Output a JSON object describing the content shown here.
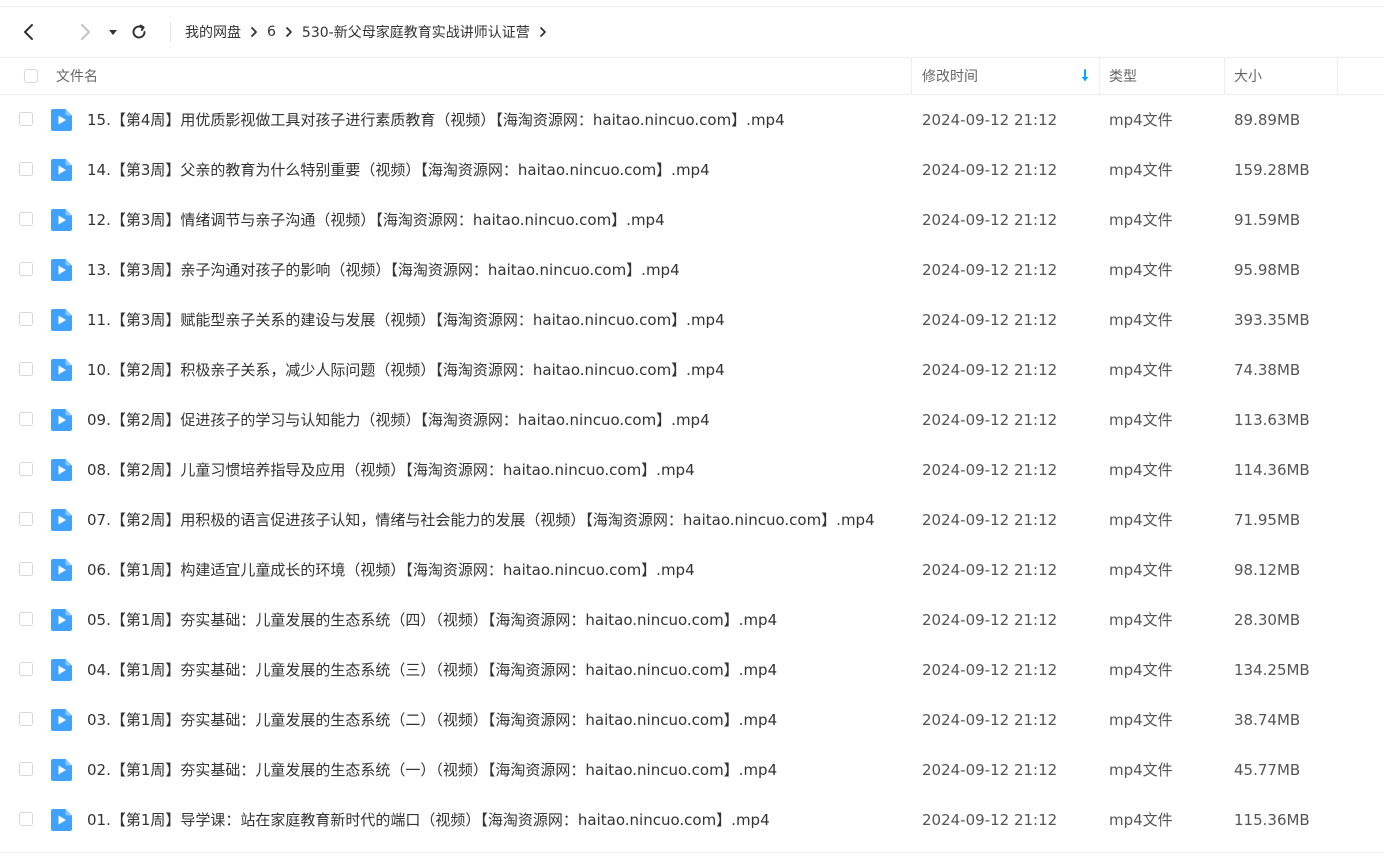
{
  "nav": {
    "back_icon": "chevron-left-icon",
    "forward_icon": "chevron-right-icon",
    "history_icon": "caret-down-icon",
    "refresh_icon": "refresh-icon"
  },
  "breadcrumb": [
    "我的网盘",
    "6",
    "530-新父母家庭教育实战讲师认证营"
  ],
  "columns": {
    "name": "文件名",
    "modified": "修改时间",
    "type": "类型",
    "size": "大小",
    "sort_icon": "arrow-down-icon",
    "accent_color": "#06a7ff"
  },
  "files": [
    {
      "name": "15.【第4周】用优质影视做工具对孩子进行素质教育（视频）【海淘资源网：haitao.nincuo.com】.mp4",
      "modified": "2024-09-12 21:12",
      "type": "mp4文件",
      "size": "89.89MB"
    },
    {
      "name": "14.【第3周】父亲的教育为什么特别重要（视频）【海淘资源网：haitao.nincuo.com】.mp4",
      "modified": "2024-09-12 21:12",
      "type": "mp4文件",
      "size": "159.28MB"
    },
    {
      "name": "12.【第3周】情绪调节与亲子沟通（视频）【海淘资源网：haitao.nincuo.com】.mp4",
      "modified": "2024-09-12 21:12",
      "type": "mp4文件",
      "size": "91.59MB"
    },
    {
      "name": "13.【第3周】亲子沟通对孩子的影响（视频）【海淘资源网：haitao.nincuo.com】.mp4",
      "modified": "2024-09-12 21:12",
      "type": "mp4文件",
      "size": "95.98MB"
    },
    {
      "name": "11.【第3周】赋能型亲子关系的建设与发展（视频）【海淘资源网：haitao.nincuo.com】.mp4",
      "modified": "2024-09-12 21:12",
      "type": "mp4文件",
      "size": "393.35MB"
    },
    {
      "name": "10.【第2周】积极亲子关系，减少人际问题（视频）【海淘资源网：haitao.nincuo.com】.mp4",
      "modified": "2024-09-12 21:12",
      "type": "mp4文件",
      "size": "74.38MB"
    },
    {
      "name": "09.【第2周】促进孩子的学习与认知能力（视频）【海淘资源网：haitao.nincuo.com】.mp4",
      "modified": "2024-09-12 21:12",
      "type": "mp4文件",
      "size": "113.63MB"
    },
    {
      "name": "08.【第2周】儿童习惯培养指导及应用（视频）【海淘资源网：haitao.nincuo.com】.mp4",
      "modified": "2024-09-12 21:12",
      "type": "mp4文件",
      "size": "114.36MB"
    },
    {
      "name": "07.【第2周】用积极的语言促进孩子认知，情绪与社会能力的发展（视频）【海淘资源网：haitao.nincuo.com】.mp4",
      "modified": "2024-09-12 21:12",
      "type": "mp4文件",
      "size": "71.95MB"
    },
    {
      "name": "06.【第1周】构建适宜儿童成长的环境（视频）【海淘资源网：haitao.nincuo.com】.mp4",
      "modified": "2024-09-12 21:12",
      "type": "mp4文件",
      "size": "98.12MB"
    },
    {
      "name": "05.【第1周】夯实基础：儿童发展的生态系统（四）（视频）【海淘资源网：haitao.nincuo.com】.mp4",
      "modified": "2024-09-12 21:12",
      "type": "mp4文件",
      "size": "28.30MB"
    },
    {
      "name": "04.【第1周】夯实基础：儿童发展的生态系统（三）（视频）【海淘资源网：haitao.nincuo.com】.mp4",
      "modified": "2024-09-12 21:12",
      "type": "mp4文件",
      "size": "134.25MB"
    },
    {
      "name": "03.【第1周】夯实基础：儿童发展的生态系统（二）（视频）【海淘资源网：haitao.nincuo.com】.mp4",
      "modified": "2024-09-12 21:12",
      "type": "mp4文件",
      "size": "38.74MB"
    },
    {
      "name": "02.【第1周】夯实基础：儿童发展的生态系统（一）（视频）【海淘资源网：haitao.nincuo.com】.mp4",
      "modified": "2024-09-12 21:12",
      "type": "mp4文件",
      "size": "45.77MB"
    },
    {
      "name": "01.【第1周】导学课：站在家庭教育新时代的端口（视频）【海淘资源网：haitao.nincuo.com】.mp4",
      "modified": "2024-09-12 21:12",
      "type": "mp4文件",
      "size": "115.36MB"
    }
  ],
  "file_icon": "video-file-icon",
  "file_icon_color": "#3fa2ff"
}
